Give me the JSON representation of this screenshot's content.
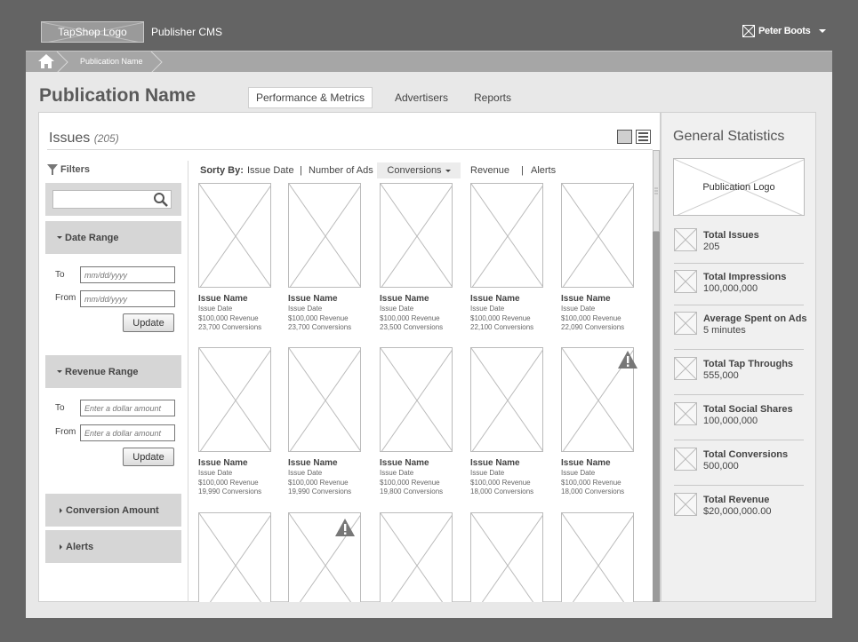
{
  "header": {
    "logo_text": "TapShop Logo",
    "app_title": "Publisher CMS",
    "user_name": "Peter Boots"
  },
  "breadcrumb": {
    "home_icon": "home-icon",
    "current": "Publication Name"
  },
  "page": {
    "title": "Publication Name"
  },
  "tabs": [
    {
      "label": "Performance & Metrics",
      "active": true
    },
    {
      "label": "Advertisers"
    },
    {
      "label": "Reports"
    }
  ],
  "issues": {
    "title": "Issues",
    "count": "(205)"
  },
  "filters": {
    "label": "Filters",
    "search_icon": "search-icon",
    "date_range": {
      "title": "Date Range",
      "to_label": "To",
      "from_label": "From",
      "to_placeholder": "mm/dd/yyyy",
      "from_placeholder": "mm/dd/yyyy",
      "button": "Update"
    },
    "revenue_range": {
      "title": "Revenue Range",
      "to_label": "To",
      "from_label": "From",
      "to_placeholder": "Enter a dollar amount",
      "from_placeholder": "Enter a dollar amount",
      "button": "Update"
    },
    "conversion_amount": "Conversion Amount",
    "alerts": "Alerts"
  },
  "sort": {
    "label": "Sorty By:",
    "options": [
      "Issue Date",
      "|",
      "Number of Ads",
      "Conversions",
      "Revenue",
      "|",
      "Alerts"
    ],
    "active": "Conversions"
  },
  "cards": [
    {
      "name": "Issue Name",
      "date": "Issue Date",
      "revenue": "$100,000 Revenue",
      "conversions": "23,700 Conversions"
    },
    {
      "name": "Issue Name",
      "date": "Issue Date",
      "revenue": "$100,000 Revenue",
      "conversions": "23,700 Conversions"
    },
    {
      "name": "Issue Name",
      "date": "Issue Date",
      "revenue": "$100,000 Revenue",
      "conversions": "23,500 Conversions"
    },
    {
      "name": "Issue Name",
      "date": "Issue Date",
      "revenue": "$100,000 Revenue",
      "conversions": "22,100 Conversions"
    },
    {
      "name": "Issue Name",
      "date": "Issue Date",
      "revenue": "$100,000 Revenue",
      "conversions": "22,090 Conversions"
    },
    {
      "name": "Issue Name",
      "date": "Issue Date",
      "revenue": "$100,000 Revenue",
      "conversions": "19,990 Conversions"
    },
    {
      "name": "Issue Name",
      "date": "Issue Date",
      "revenue": "$100,000 Revenue",
      "conversions": "19,990 Conversions"
    },
    {
      "name": "Issue Name",
      "date": "Issue Date",
      "revenue": "$100,000 Revenue",
      "conversions": "19,800 Conversions"
    },
    {
      "name": "Issue Name",
      "date": "Issue Date",
      "revenue": "$100,000 Revenue",
      "conversions": "18,000 Conversions"
    },
    {
      "name": "Issue Name",
      "date": "Issue Date",
      "revenue": "$100,000 Revenue",
      "conversions": "18,000 Conversions",
      "alert": true
    }
  ],
  "general_stats": {
    "title": "General Statistics",
    "logo_text": "Publication Logo",
    "items": [
      {
        "label": "Total Issues",
        "value": "205"
      },
      {
        "label": "Total Impressions",
        "value": "100,000,000"
      },
      {
        "label": "Average Spent on Ads",
        "value": "5 minutes"
      },
      {
        "label": "Total Tap Throughs",
        "value": "555,000"
      },
      {
        "label": "Total Social Shares",
        "value": "100,000,000"
      },
      {
        "label": "Total Conversions",
        "value": "500,000"
      },
      {
        "label": "Total Revenue",
        "value": "$20,000,000.00"
      }
    ]
  },
  "colors": {
    "background": "#646464",
    "page": "#e8e8e8",
    "panel": "#ffffff",
    "section": "#d6d6d6"
  }
}
